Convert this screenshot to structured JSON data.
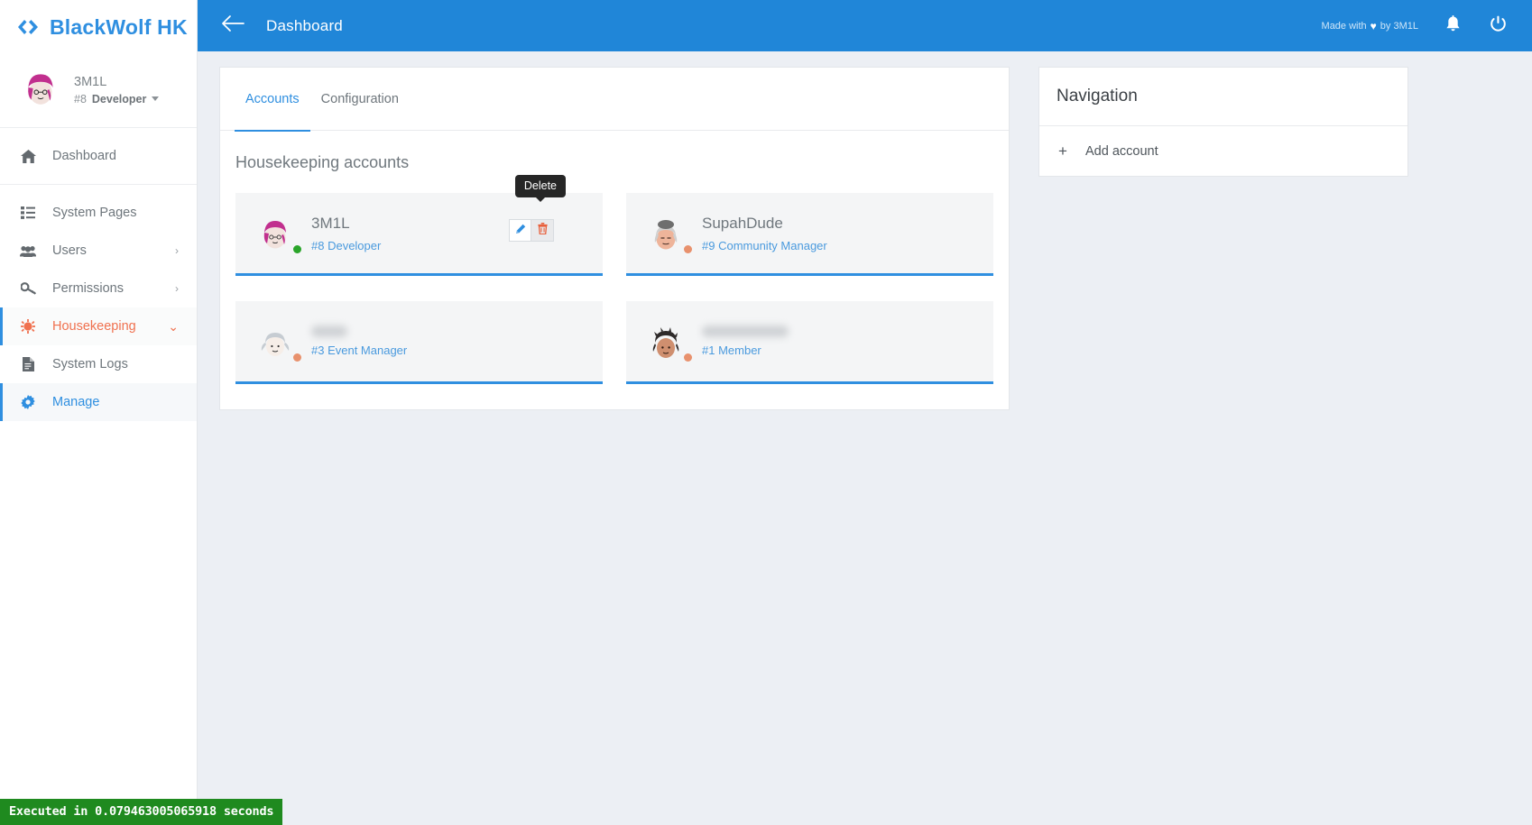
{
  "brand": {
    "name": "BlackWolf HK",
    "logo_icon": "chevrons-logo-icon",
    "color": "#2f8fe0"
  },
  "sidebar": {
    "profile": {
      "name": "3M1L",
      "role_id": "#8",
      "role": "Developer",
      "avatar_icon": "avatar-pink-hair",
      "caret_icon": "chevron-down-icon"
    },
    "groups": [
      {
        "items": [
          {
            "label": "Dashboard",
            "icon": "home-icon",
            "state": "normal",
            "arrow": ""
          }
        ]
      },
      {
        "items": [
          {
            "label": "System Pages",
            "icon": "list-icon",
            "state": "normal",
            "arrow": ""
          },
          {
            "label": "Users",
            "icon": "users-icon",
            "state": "normal",
            "arrow": "›"
          },
          {
            "label": "Permissions",
            "icon": "key-icon",
            "state": "normal",
            "arrow": "›"
          },
          {
            "label": "Housekeeping",
            "icon": "gear-sun-icon",
            "state": "active-orange",
            "arrow": "⌄"
          },
          {
            "label": "System Logs",
            "icon": "document-icon",
            "state": "normal",
            "arrow": ""
          },
          {
            "label": "Manage",
            "icon": "cog-icon",
            "state": "active-blue",
            "arrow": ""
          }
        ]
      }
    ]
  },
  "topbar": {
    "back_icon": "arrow-left-icon",
    "title": "Dashboard",
    "credit_prefix": "Made with",
    "credit_heart": "♥",
    "credit_suffix": "by 3M1L",
    "bell_icon": "bell-icon",
    "power_icon": "power-icon",
    "bg_color": "#2086d8"
  },
  "accounts_panel": {
    "tabs": [
      {
        "label": "Accounts",
        "active": true
      },
      {
        "label": "Configuration",
        "active": false
      }
    ],
    "title": "Housekeeping accounts",
    "tooltip": "Delete",
    "edit_icon": "pencil-icon",
    "delete_icon": "trash-icon",
    "cards": [
      {
        "name": "3M1L",
        "name_blurred": false,
        "role_id": "#8",
        "role": "Developer",
        "role_full": "#8 Developer",
        "avatar_icon": "avatar-pink-hair",
        "status_color": "#2aa52a",
        "has_actions": true
      },
      {
        "name": "SupahDude",
        "name_blurred": false,
        "role_id": "#9",
        "role": "Community Manager",
        "role_full": "#9 Community Manager",
        "avatar_icon": "avatar-grey-wig",
        "status_color": "#e8916d",
        "has_actions": false
      },
      {
        "name": "",
        "name_blurred": true,
        "blur_width": 40,
        "role_id": "#3",
        "role": "Event Manager",
        "role_full": "#3 Event Manager",
        "avatar_icon": "avatar-white-hair",
        "status_color": "#e8916d",
        "has_actions": false
      },
      {
        "name": "",
        "name_blurred": true,
        "blur_width": 96,
        "role_id": "#1",
        "role": "Member",
        "role_full": "#1 Member",
        "avatar_icon": "avatar-dark-curly",
        "status_color": "#e8916d",
        "has_actions": false
      }
    ],
    "accent_color": "#2f8fe0"
  },
  "navigation_panel": {
    "title": "Navigation",
    "items": [
      {
        "label": "Add account",
        "icon": "plus-icon"
      }
    ]
  },
  "statusbar": {
    "text": "Executed in 0.079463005065918 seconds",
    "bg_color": "#1f8a1f"
  }
}
